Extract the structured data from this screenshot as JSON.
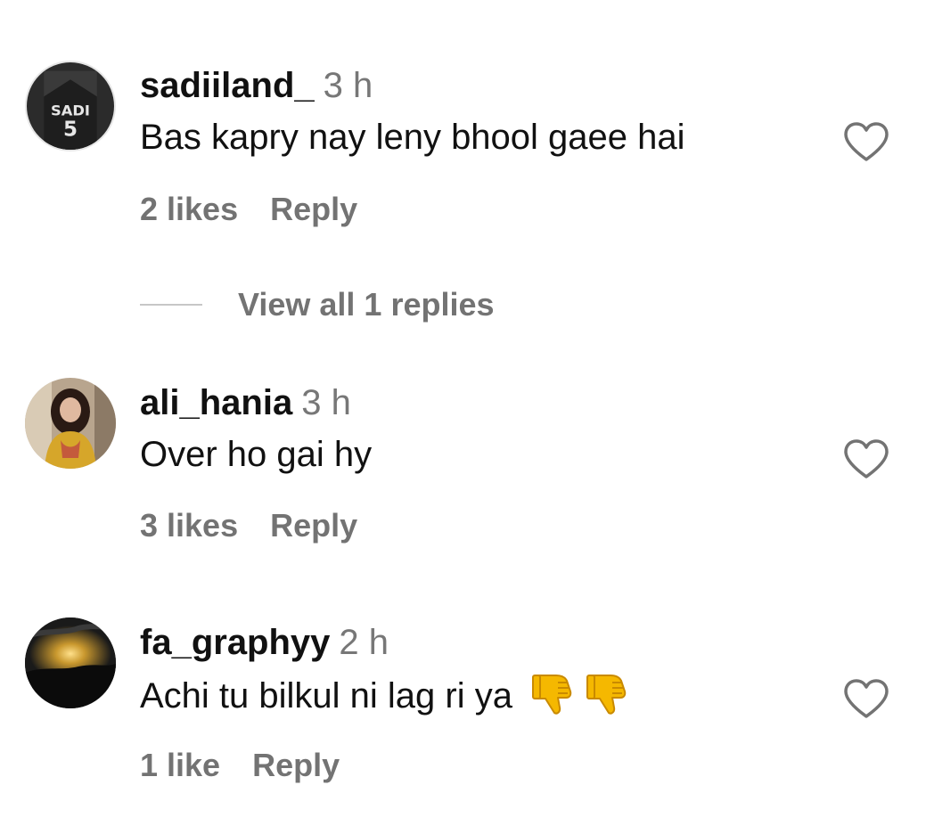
{
  "comments": [
    {
      "username": "sadiiland_",
      "time": "3 h",
      "text": "Bas kapry nay leny bhool gaee hai",
      "likes": "2 likes",
      "reply_label": "Reply",
      "avatar_text": "SADI",
      "avatar_number": "5"
    },
    {
      "username": "ali_hania",
      "time": "3 h",
      "text": "Over ho gai hy",
      "likes": "3 likes",
      "reply_label": "Reply"
    },
    {
      "username": "fa_graphyy",
      "time": "2 h",
      "text": "Achi tu bilkul ni lag ri ya",
      "likes": "1 like",
      "reply_label": "Reply"
    }
  ],
  "view_replies": {
    "label": "View all 1 replies"
  },
  "colors": {
    "text": "#111111",
    "muted": "#737373",
    "time": "#777777",
    "divider": "#c7c7c7",
    "emoji_yellow": "#f5b800"
  }
}
